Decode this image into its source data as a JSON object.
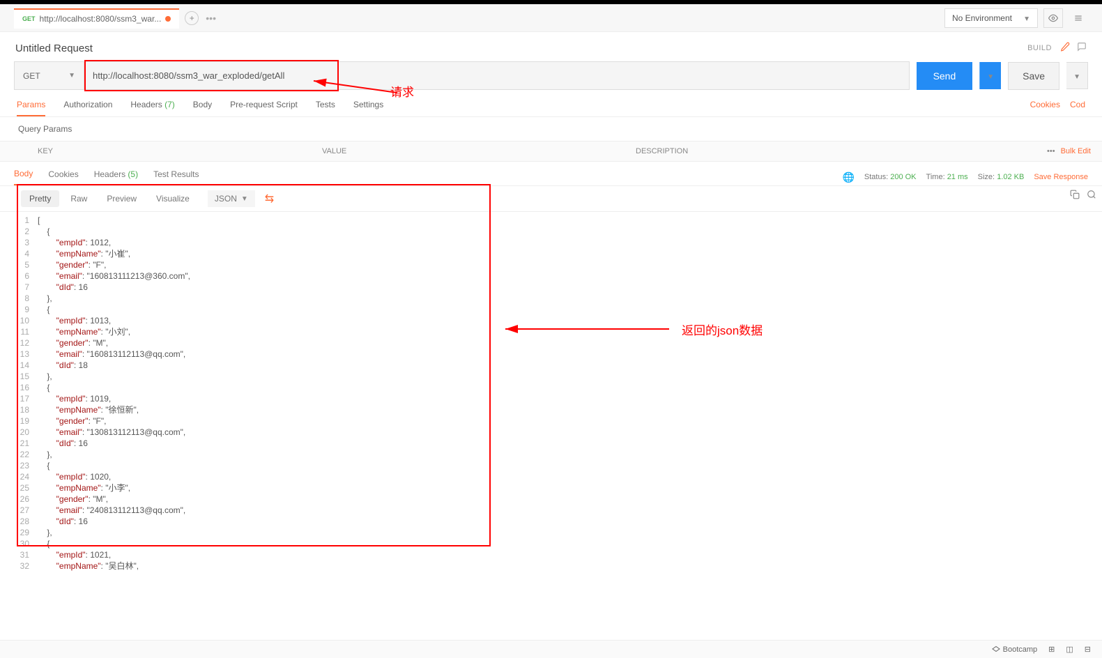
{
  "tab": {
    "method": "GET",
    "text": "http://localhost:8080/ssm3_war...",
    "dirty": true
  },
  "env": {
    "selected": "No Environment"
  },
  "request": {
    "title": "Untitled Request",
    "build": "BUILD",
    "method": "GET",
    "url": "http://localhost:8080/ssm3_war_exploded/getAll",
    "send": "Send",
    "save": "Save"
  },
  "reqtabs": {
    "params": "Params",
    "auth": "Authorization",
    "headers": "Headers",
    "headers_count": "(7)",
    "body": "Body",
    "prereq": "Pre-request Script",
    "tests": "Tests",
    "settings": "Settings",
    "cookies": "Cookies",
    "code": "Cod"
  },
  "queryparams": "Query Params",
  "paramhead": {
    "key": "KEY",
    "value": "VALUE",
    "desc": "DESCRIPTION",
    "bulk": "Bulk Edit",
    "dots": "•••"
  },
  "resptabs": {
    "body": "Body",
    "cookies": "Cookies",
    "headers": "Headers",
    "headers_count": "(5)",
    "testresults": "Test Results"
  },
  "respstatus": {
    "status_label": "Status:",
    "status_val": "200 OK",
    "time_label": "Time:",
    "time_val": "21 ms",
    "size_label": "Size:",
    "size_val": "1.02 KB",
    "saveresp": "Save Response"
  },
  "viewtabs": {
    "pretty": "Pretty",
    "raw": "Raw",
    "preview": "Preview",
    "visualize": "Visualize",
    "json": "JSON"
  },
  "annotations": {
    "request": "请求",
    "response": "返回的json数据"
  },
  "footer": {
    "bootcamp": "Bootcamp"
  },
  "code_lines": [
    {
      "n": 1,
      "c": "["
    },
    {
      "n": 2,
      "c": "    {"
    },
    {
      "n": 3,
      "c": "        \"empId\": 1012,"
    },
    {
      "n": 4,
      "c": "        \"empName\": \"小崔\","
    },
    {
      "n": 5,
      "c": "        \"gender\": \"F\","
    },
    {
      "n": 6,
      "c": "        \"email\": \"160813111213@360.com\","
    },
    {
      "n": 7,
      "c": "        \"dId\": 16"
    },
    {
      "n": 8,
      "c": "    },"
    },
    {
      "n": 9,
      "c": "    {"
    },
    {
      "n": 10,
      "c": "        \"empId\": 1013,"
    },
    {
      "n": 11,
      "c": "        \"empName\": \"小刘\","
    },
    {
      "n": 12,
      "c": "        \"gender\": \"M\","
    },
    {
      "n": 13,
      "c": "        \"email\": \"160813112113@qq.com\","
    },
    {
      "n": 14,
      "c": "        \"dId\": 18"
    },
    {
      "n": 15,
      "c": "    },"
    },
    {
      "n": 16,
      "c": "    {"
    },
    {
      "n": 17,
      "c": "        \"empId\": 1019,"
    },
    {
      "n": 18,
      "c": "        \"empName\": \"徐恒新\","
    },
    {
      "n": 19,
      "c": "        \"gender\": \"F\","
    },
    {
      "n": 20,
      "c": "        \"email\": \"130813112113@qq.com\","
    },
    {
      "n": 21,
      "c": "        \"dId\": 16"
    },
    {
      "n": 22,
      "c": "    },"
    },
    {
      "n": 23,
      "c": "    {"
    },
    {
      "n": 24,
      "c": "        \"empId\": 1020,"
    },
    {
      "n": 25,
      "c": "        \"empName\": \"小李\","
    },
    {
      "n": 26,
      "c": "        \"gender\": \"M\","
    },
    {
      "n": 27,
      "c": "        \"email\": \"240813112113@qq.com\","
    },
    {
      "n": 28,
      "c": "        \"dId\": 16"
    },
    {
      "n": 29,
      "c": "    },"
    },
    {
      "n": 30,
      "c": "    {"
    },
    {
      "n": 31,
      "c": "        \"empId\": 1021,"
    },
    {
      "n": 32,
      "c": "        \"empName\": \"吴白林\","
    }
  ]
}
